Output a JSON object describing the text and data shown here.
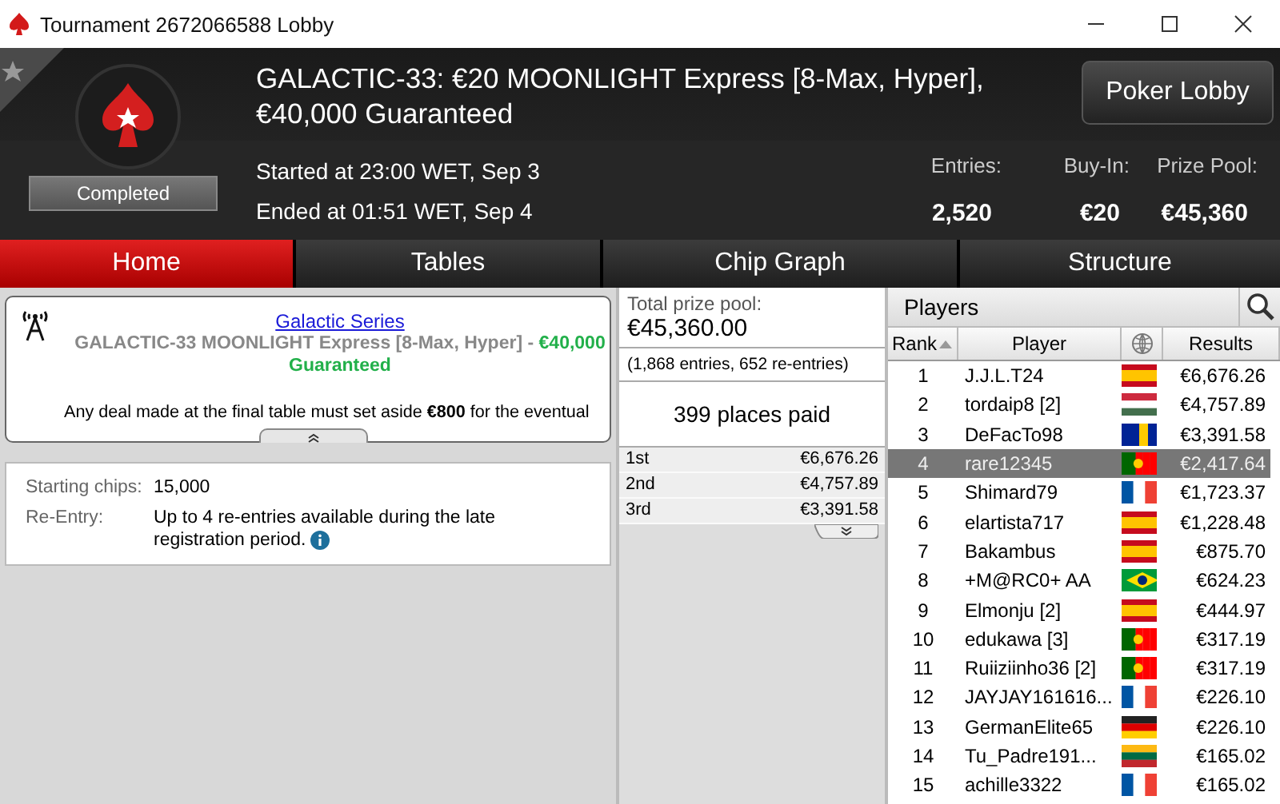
{
  "window": {
    "title": "Tournament 2672066588 Lobby"
  },
  "header": {
    "title": "GALACTIC-33: €20 MOONLIGHT Express [8-Max, Hyper], €40,000 Guaranteed",
    "status": "Completed",
    "started": "Started at 23:00 WET, Sep 3",
    "ended": "Ended at 01:51 WET, Sep 4",
    "lobby_button": "Poker Lobby",
    "stats": [
      {
        "label": "Entries:",
        "value": "2,520"
      },
      {
        "label": "Buy-In:",
        "value": "€20"
      },
      {
        "label": "Prize Pool:",
        "value": "€45,360"
      }
    ]
  },
  "tabs": [
    {
      "label": "Home",
      "selected": true
    },
    {
      "label": "Tables",
      "selected": false
    },
    {
      "label": "Chip Graph",
      "selected": false
    },
    {
      "label": "Structure",
      "selected": false
    }
  ],
  "info": {
    "series_link": "Galactic Series",
    "event": "GALACTIC-33 MOONLIGHT Express [8-Max, Hyper]",
    "separator": "-",
    "guarantee": "€40,000",
    "guaranteed": "Guaranteed",
    "notice": "Any deal made at the final table must set aside **€800** for the eventual"
  },
  "details": [
    {
      "label": "Starting chips:",
      "value": "15,000",
      "info": false
    },
    {
      "label": "Re-Entry:",
      "value": "Up to 4 re-entries available during the late registration period.",
      "info": true
    }
  ],
  "prizes": {
    "total_label": "Total prize pool:",
    "total": "€45,360.00",
    "entries": "(1,868 entries, 652 re-entries)",
    "places_paid": "399 places paid",
    "places": [
      {
        "place": "1st",
        "amount": "€6,676.26"
      },
      {
        "place": "2nd",
        "amount": "€4,757.89"
      },
      {
        "place": "3rd",
        "amount": "€3,391.58"
      }
    ]
  },
  "players": {
    "title": "Players",
    "columns": [
      "Rank",
      "Player",
      "Results"
    ],
    "rows": [
      {
        "rank": "1",
        "name": "J.J.L.T24",
        "kind": "spain",
        "result": "€6,676.26",
        "selected": false
      },
      {
        "rank": "2",
        "name": "tordaip8 [2]",
        "kind": "hungary",
        "result": "€4,757.89",
        "selected": false
      },
      {
        "rank": "3",
        "name": "DeFacTo98",
        "kind": "bosnia",
        "result": "€3,391.58",
        "selected": false
      },
      {
        "rank": "4",
        "name": "rare12345",
        "kind": "portugal",
        "result": "€2,417.64",
        "selected": true
      },
      {
        "rank": "5",
        "name": "Shimard79",
        "kind": "france",
        "result": "€1,723.37",
        "selected": false
      },
      {
        "rank": "6",
        "name": "elartista717",
        "kind": "spain",
        "result": "€1,228.48",
        "selected": false
      },
      {
        "rank": "7",
        "name": "Bakambus",
        "kind": "spain",
        "result": "€875.70",
        "selected": false
      },
      {
        "rank": "8",
        "name": "+M@RC0+ AA",
        "kind": "brazil",
        "result": "€624.23",
        "selected": false
      },
      {
        "rank": "9",
        "name": "Elmonju [2]",
        "kind": "spain",
        "result": "€444.97",
        "selected": false
      },
      {
        "rank": "10",
        "name": "edukawa [3]",
        "kind": "portugal",
        "result": "€317.19",
        "selected": false
      },
      {
        "rank": "11",
        "name": "Ruiiziinho36 [2]",
        "kind": "portugal",
        "result": "€317.19",
        "selected": false
      },
      {
        "rank": "12",
        "name": "JAYJAY161616...",
        "kind": "france",
        "result": "€226.10",
        "selected": false
      },
      {
        "rank": "13",
        "name": "GermanElite65",
        "kind": "germany",
        "result": "€226.10",
        "selected": false
      },
      {
        "rank": "14",
        "name": "Tu_Padre191...",
        "kind": "lithuania",
        "result": "€165.02",
        "selected": false
      },
      {
        "rank": "15",
        "name": "achille3322",
        "kind": "france",
        "result": "€165.02",
        "selected": false
      }
    ]
  }
}
